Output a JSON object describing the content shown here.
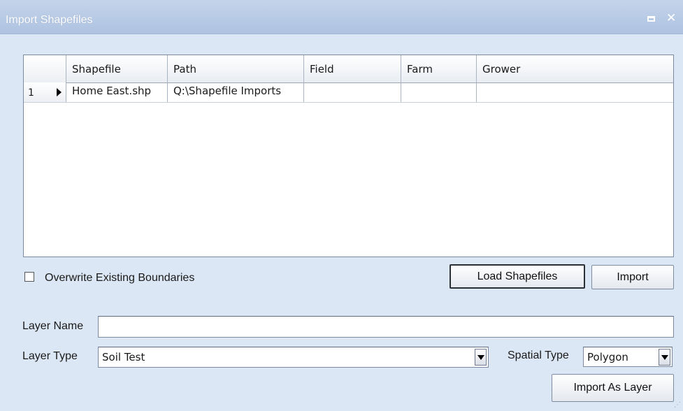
{
  "window": {
    "title": "Import Shapefiles"
  },
  "grid": {
    "columns": [
      "Shapefile",
      "Path",
      "Field",
      "Farm",
      "Grower"
    ],
    "rows": [
      {
        "number": "1",
        "cells": [
          "Home East.shp",
          "Q:\\Shapefile Imports",
          "",
          "",
          ""
        ]
      }
    ]
  },
  "overwrite": {
    "label": "Overwrite Existing Boundaries",
    "checked": false
  },
  "buttons": {
    "load_shapefiles": "Load Shapefiles",
    "import": "Import",
    "import_as_layer": "Import As Layer"
  },
  "layer_name": {
    "label": "Layer Name",
    "value": ""
  },
  "layer_type": {
    "label": "Layer Type",
    "value": "Soil Test"
  },
  "spatial_type": {
    "label": "Spatial Type",
    "value": "Polygon"
  },
  "icons": {
    "restore": "restore-icon",
    "close": "close-icon",
    "row_indicator": "current-row-arrow-icon",
    "dropdown": "dropdown-arrow-icon"
  }
}
